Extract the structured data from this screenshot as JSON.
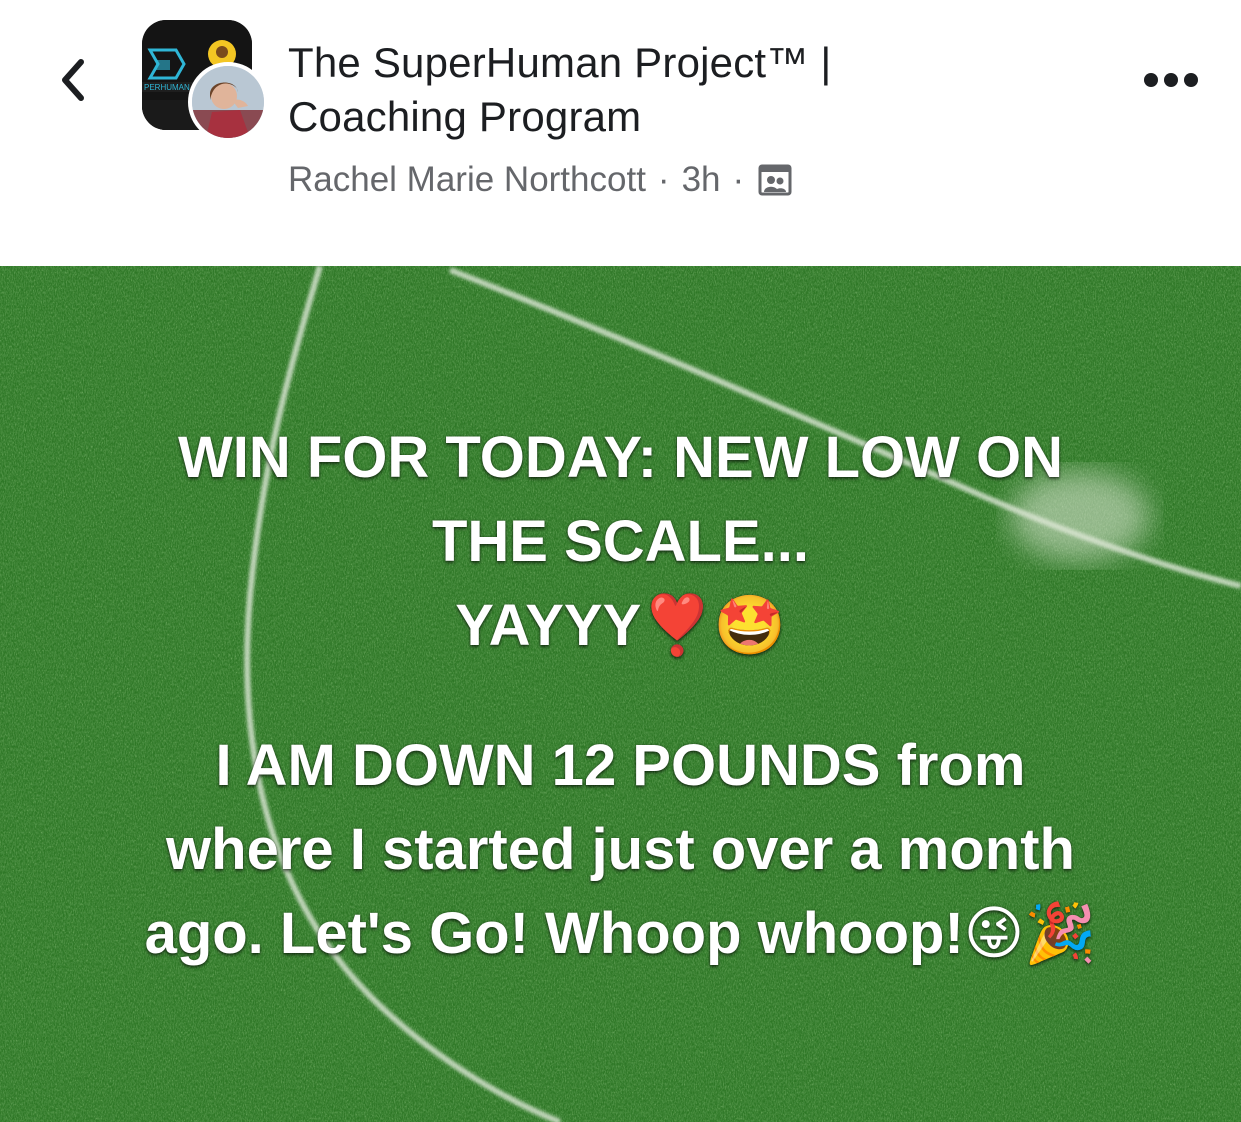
{
  "header": {
    "back_icon": "chevron-left-icon",
    "group_avatar_label": "PERHUMAN",
    "title_line1": "The SuperHuman Project™ |",
    "title_line2": "Coaching Program",
    "author": "Rachel Marie Northcott",
    "separator": "·",
    "time": "3h",
    "privacy_icon": "private-group-icon",
    "more_icon": "more-options-icon"
  },
  "post": {
    "background": "grass-field-image",
    "colors": {
      "grass": "#2f7a27",
      "text": "#ffffff"
    },
    "lines": [
      "WIN FOR TODAY: NEW LOW ON",
      "THE SCALE...",
      "YAYYY❣️🤩",
      "I AM DOWN 12 POUNDS from",
      "where I started just over a month",
      "ago. Let's Go! Whoop whoop!😜🎉"
    ]
  }
}
